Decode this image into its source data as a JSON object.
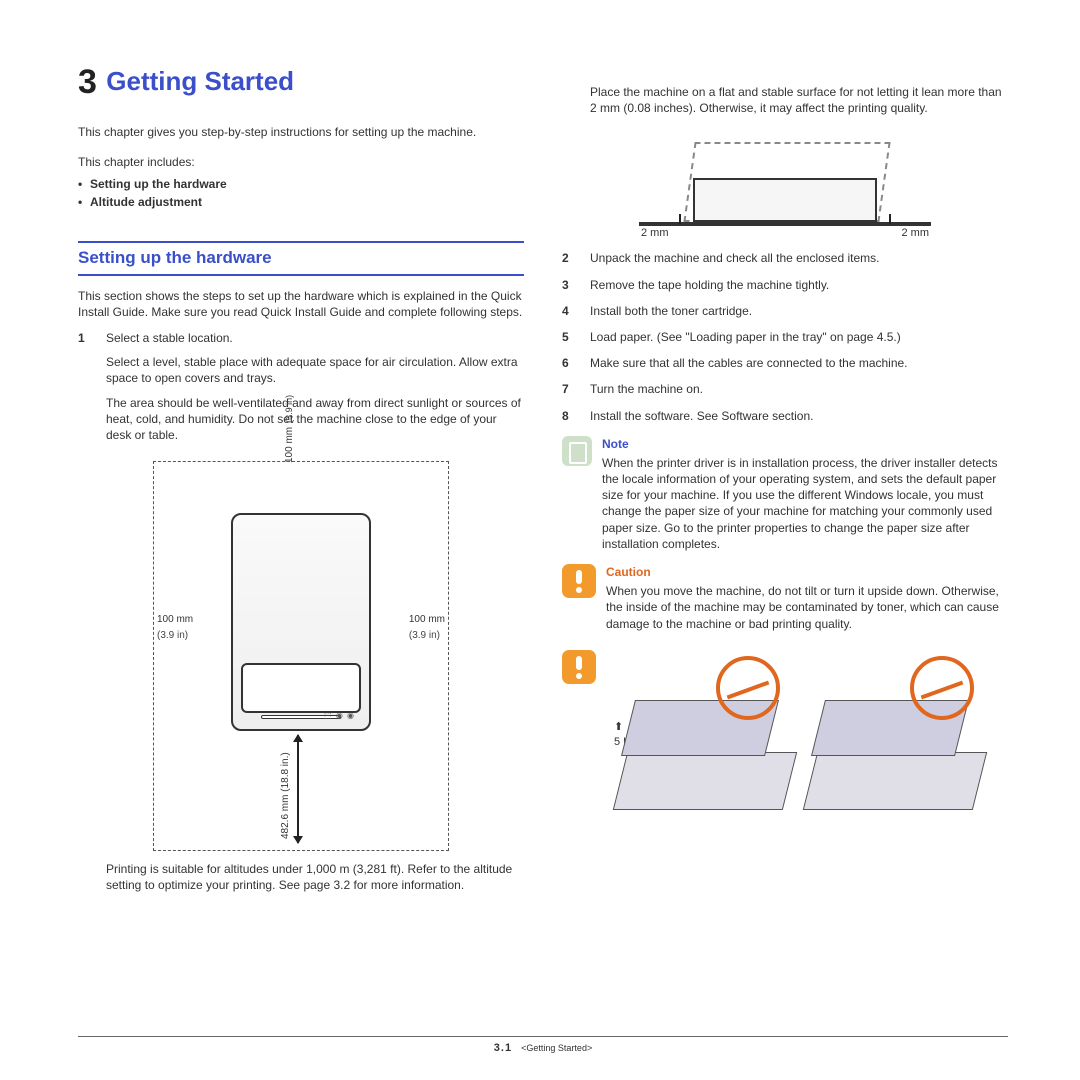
{
  "chapter": {
    "number": "3",
    "title": "Getting Started"
  },
  "intro": "This chapter gives you step-by-step instructions for setting up the machine.",
  "includes_label": "This chapter includes:",
  "toc": [
    "Setting up the hardware",
    "Altitude adjustment"
  ],
  "section": {
    "title": "Setting up the hardware",
    "intro": "This section shows the steps to set up the hardware which is explained in the Quick Install Guide. Make sure you read Quick Install Guide and complete following steps."
  },
  "step1": {
    "n": "1",
    "title": "Select a stable location.",
    "p1": "Select a level, stable place with adequate space for air circulation. Allow extra space to open covers and trays.",
    "p2": "The area should be well-ventilated and away from direct sunlight or sources of heat, cold, and humidity. Do not set the machine close to the edge of your desk or table.",
    "altitude": "Printing is suitable for altitudes under 1,000 m (3,281 ft). Refer to the altitude setting to optimize your printing. See page 3.2 for more information."
  },
  "fig1": {
    "left_mm": "100 mm",
    "left_in": "(3.9 in)",
    "right_mm": "100 mm",
    "right_in": "(3.9 in)",
    "top_mm": "100 mm",
    "top_in": "(3.9 in)",
    "front": "482.6 mm (18.8 in.)"
  },
  "col2_top": "Place the machine on a flat and stable surface for not letting it lean more than 2 mm (0.08 inches). Otherwise, it may affect the printing quality.",
  "fig2": {
    "left": "2 mm",
    "right": "2 mm"
  },
  "steps_rest": [
    {
      "n": "2",
      "t": "Unpack the machine and check all the enclosed items."
    },
    {
      "n": "3",
      "t": "Remove the tape holding the machine tightly."
    },
    {
      "n": "4",
      "t": "Install both the toner cartridge."
    },
    {
      "n": "5",
      "t": "Load paper. (See \"Loading paper in the tray\" on page 4.5.)"
    },
    {
      "n": "6",
      "t": "Make sure that all the cables are connected to the machine."
    },
    {
      "n": "7",
      "t": "Turn the machine on."
    },
    {
      "n": "8",
      "t": "Install the software. See Software section."
    }
  ],
  "note": {
    "title": "Note",
    "body": "When the printer driver is in installation process, the driver installer detects the locale information of your operating system, and sets the default paper size for your machine. If you use the different Windows locale, you must change the paper size of your machine for matching your commonly used paper size. Go to the printer properties to change the paper size after installation completes."
  },
  "caution": {
    "title": "Caution",
    "body": "When you move the machine, do not tilt or turn it upside down. Otherwise, the inside of the machine may be contaminated by toner, which can cause damage to the machine or bad printing quality."
  },
  "fig3": {
    "weight": "5 Kg (11 lbs)"
  },
  "footer": {
    "page": "3.1",
    "chapter": "<Getting Started>"
  }
}
